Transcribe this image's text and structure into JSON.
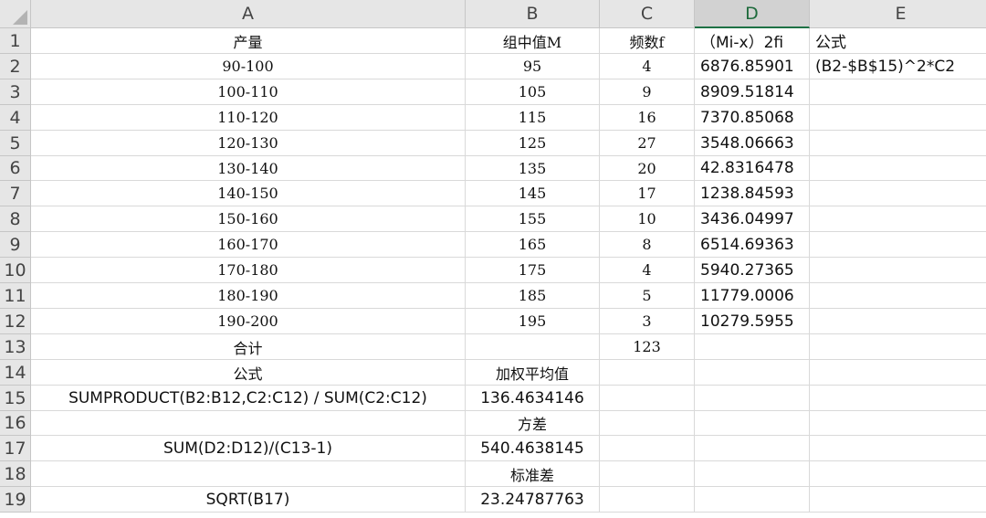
{
  "columns": [
    "A",
    "B",
    "C",
    "D",
    "E"
  ],
  "selected_column": "D",
  "rows": [
    {
      "n": "1",
      "A": "产量",
      "B": "组中值M",
      "C": "频数f",
      "D": "（Mi-x）2fi",
      "E": "公式"
    },
    {
      "n": "2",
      "A": "90-100",
      "B": "95",
      "C": "4",
      "D": "6876.85901",
      "E": "(B2-$B$15)^2*C2"
    },
    {
      "n": "3",
      "A": "100-110",
      "B": "105",
      "C": "9",
      "D": "8909.51814",
      "E": ""
    },
    {
      "n": "4",
      "A": "110-120",
      "B": "115",
      "C": "16",
      "D": "7370.85068",
      "E": ""
    },
    {
      "n": "5",
      "A": "120-130",
      "B": "125",
      "C": "27",
      "D": "3548.06663",
      "E": ""
    },
    {
      "n": "6",
      "A": "130-140",
      "B": "135",
      "C": "20",
      "D": "42.8316478",
      "E": ""
    },
    {
      "n": "7",
      "A": "140-150",
      "B": "145",
      "C": "17",
      "D": "1238.84593",
      "E": ""
    },
    {
      "n": "8",
      "A": "150-160",
      "B": "155",
      "C": "10",
      "D": "3436.04997",
      "E": ""
    },
    {
      "n": "9",
      "A": "160-170",
      "B": "165",
      "C": "8",
      "D": "6514.69363",
      "E": ""
    },
    {
      "n": "10",
      "A": "170-180",
      "B": "175",
      "C": "4",
      "D": "5940.27365",
      "E": ""
    },
    {
      "n": "11",
      "A": "180-190",
      "B": "185",
      "C": "5",
      "D": "11779.0006",
      "E": ""
    },
    {
      "n": "12",
      "A": "190-200",
      "B": "195",
      "C": "3",
      "D": "10279.5955",
      "E": ""
    },
    {
      "n": "13",
      "A": "合计",
      "B": "",
      "C": "123",
      "D": "",
      "E": ""
    },
    {
      "n": "14",
      "A": "公式",
      "B": "加权平均值",
      "C": "",
      "D": "",
      "E": ""
    },
    {
      "n": "15",
      "A": "SUMPRODUCT(B2:B12,C2:C12) / SUM(C2:C12)",
      "B": "136.4634146",
      "C": "",
      "D": "",
      "E": ""
    },
    {
      "n": "16",
      "A": "",
      "B": "方差",
      "C": "",
      "D": "",
      "E": ""
    },
    {
      "n": "17",
      "A": "SUM(D2:D12)/(C13-1)",
      "B": "540.4638145",
      "C": "",
      "D": "",
      "E": ""
    },
    {
      "n": "18",
      "A": "",
      "B": "标准差",
      "C": "",
      "D": "",
      "E": ""
    },
    {
      "n": "19",
      "A": "SQRT(B17)",
      "B": "23.24787763",
      "C": "",
      "D": "",
      "E": ""
    }
  ]
}
